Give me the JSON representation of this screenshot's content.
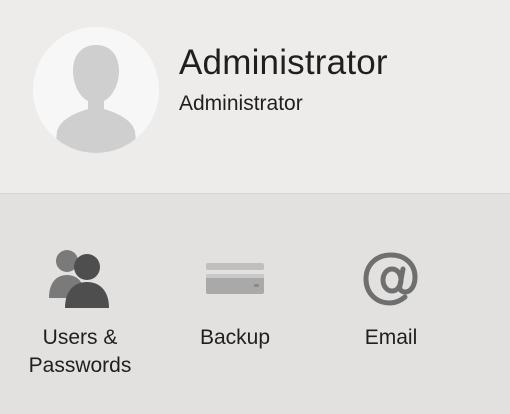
{
  "account": {
    "name": "Administrator",
    "role": "Administrator",
    "avatar_icon": "default-user-silhouette-icon"
  },
  "panes": [
    {
      "label": "Users &\nPasswords",
      "icon": "users-group-icon"
    },
    {
      "label": "Backup",
      "icon": "backup-drive-icon"
    },
    {
      "label": "Email",
      "icon": "at-sign-icon"
    }
  ],
  "colors": {
    "header_bg": "#edeceb",
    "panel_bg": "#e2e1e0",
    "text": "#1f1f1f",
    "icon_gray": "#6f6f6f"
  }
}
